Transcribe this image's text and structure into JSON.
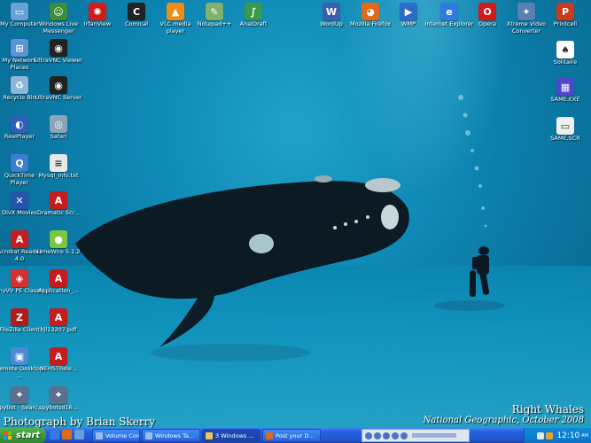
{
  "wallpaper": {
    "caption_left": "Photograph by Brian Skerry",
    "caption_right_line1": "Right Whales",
    "caption_right_line2": "National Geographic, October 2008"
  },
  "desktop_icons_left": [
    {
      "label": "My Computer",
      "icon": "my-computer-icon",
      "color": "#6aa0d8",
      "glyph": "▭"
    },
    {
      "label": "Windows Live Messenger",
      "icon": "messenger-icon",
      "color": "#3b8e3b",
      "glyph": "☺"
    },
    {
      "label": "IrfanView",
      "icon": "irfanview-icon",
      "color": "#d21b1b",
      "glyph": "✺"
    },
    {
      "label": "Comical",
      "icon": "comical-icon",
      "color": "#222222",
      "glyph": "C"
    },
    {
      "label": "VLC media player",
      "icon": "vlc-icon",
      "color": "#f08c1a",
      "glyph": "▲"
    },
    {
      "label": "Notepad++",
      "icon": "notepadpp-icon",
      "color": "#7fb26a",
      "glyph": "✎"
    },
    {
      "label": "AnalDraft",
      "icon": "analdraft-icon",
      "color": "#3a9a4a",
      "glyph": "∫"
    }
  ],
  "desktop_icons_col1": [
    {
      "label": "My Network Places",
      "icon": "network-places-icon",
      "color": "#5e93d6",
      "glyph": "⊞"
    },
    {
      "label": "Recycle Bin",
      "icon": "recycle-bin-icon",
      "color": "#8fb6d8",
      "glyph": "♻"
    },
    {
      "label": "RealPlayer",
      "icon": "realplayer-icon",
      "color": "#2c5fb5",
      "glyph": "◐"
    },
    {
      "label": "QuickTime Player",
      "icon": "quicktime-icon",
      "color": "#3c7fd1",
      "glyph": "Q"
    },
    {
      "label": "DivX Movies",
      "icon": "divx-icon",
      "color": "#2455a8",
      "glyph": "✕"
    },
    {
      "label": "Acrobat Reader 4.0",
      "icon": "acrobat-icon",
      "color": "#c81c1c",
      "glyph": "A"
    },
    {
      "label": "AnyVV PE Classic",
      "icon": "anyvv-icon",
      "color": "#d43030",
      "glyph": "◈"
    },
    {
      "label": "FileZilla Client",
      "icon": "filezilla-icon",
      "color": "#b11b1b",
      "glyph": "Z"
    },
    {
      "label": "Remote Desktop ...",
      "icon": "remote-desktop-icon",
      "color": "#4d8ad6",
      "glyph": "▣"
    },
    {
      "label": "Spybot - Searc...",
      "icon": "spybot-icon",
      "color": "#5b6f8f",
      "glyph": "⌖"
    }
  ],
  "desktop_icons_col2": [
    {
      "label": "UltraVNC Viewer",
      "icon": "ultravnc-viewer-icon",
      "color": "#222222",
      "glyph": "◉"
    },
    {
      "label": "UltraVNC Server",
      "icon": "ultravnc-server-icon",
      "color": "#222222",
      "glyph": "◉"
    },
    {
      "label": "Safari",
      "icon": "safari-icon",
      "color": "#8da3b8",
      "glyph": "◎"
    },
    {
      "label": "Mysql_info.txt",
      "icon": "text-file-icon",
      "color": "#e8e8e8",
      "glyph": "≡"
    },
    {
      "label": "Dramatic Scr...",
      "icon": "pdf-file-icon",
      "color": "#c41d1d",
      "glyph": "A"
    },
    {
      "label": "LimeWire 5.1.2",
      "icon": "limewire-icon",
      "color": "#7bc83f",
      "glyph": "●"
    },
    {
      "label": "Application_...",
      "icon": "pdf-file-icon",
      "color": "#c41d1d",
      "glyph": "A"
    },
    {
      "label": "bjl13207.pdf",
      "icon": "pdf-file-icon",
      "color": "#c41d1d",
      "glyph": "A"
    },
    {
      "label": "NEHSTRele...",
      "icon": "pdf-file-icon",
      "color": "#c41d1d",
      "glyph": "A"
    },
    {
      "label": "spybotsd16...",
      "icon": "installer-icon",
      "color": "#5b6f8f",
      "glyph": "⌖"
    }
  ],
  "desktop_icons_top_right": [
    {
      "label": "WordUp",
      "icon": "wordup-icon",
      "color": "#3b5fb0",
      "glyph": "W"
    },
    {
      "label": "Mozilla Firefox",
      "icon": "firefox-icon",
      "color": "#e06a1b",
      "glyph": "◕"
    },
    {
      "label": "WMP",
      "icon": "wmp-icon",
      "color": "#2a6cc8",
      "glyph": "▶"
    },
    {
      "label": "Internet Explorer",
      "icon": "internet-explorer-icon",
      "color": "#2f7be0",
      "glyph": "e"
    },
    {
      "label": "Opera",
      "icon": "opera-icon",
      "color": "#d11b1b",
      "glyph": "O"
    },
    {
      "label": "Xtreme Video Converter",
      "icon": "video-converter-icon",
      "color": "#5a7fb0",
      "glyph": "✦"
    },
    {
      "label": "Printcell",
      "icon": "printcell-icon",
      "color": "#c93b1b",
      "glyph": "P"
    }
  ],
  "desktop_icons_right_col": [
    {
      "label": "Solitaire",
      "icon": "solitaire-icon",
      "color": "#ffffff",
      "glyph": "♠"
    },
    {
      "label": "SAME.EXE",
      "icon": "same-exe-icon",
      "color": "#5046c8",
      "glyph": "▦"
    },
    {
      "label": "SAME.SCR",
      "icon": "screensaver-icon",
      "color": "#f0f0f0",
      "glyph": "▭"
    }
  ],
  "taskbar": {
    "start_label": "start",
    "tasks": [
      {
        "label": "Volume Control",
        "color": "#9bbce8"
      },
      {
        "label": "Windows Ta...",
        "color": "#9bbce8"
      },
      {
        "label": "3 Windows ...",
        "color": "#f0c850"
      },
      {
        "label": "Post your D...",
        "color": "#e06a1b"
      }
    ],
    "clock": "12:10",
    "ampm": "AM"
  }
}
